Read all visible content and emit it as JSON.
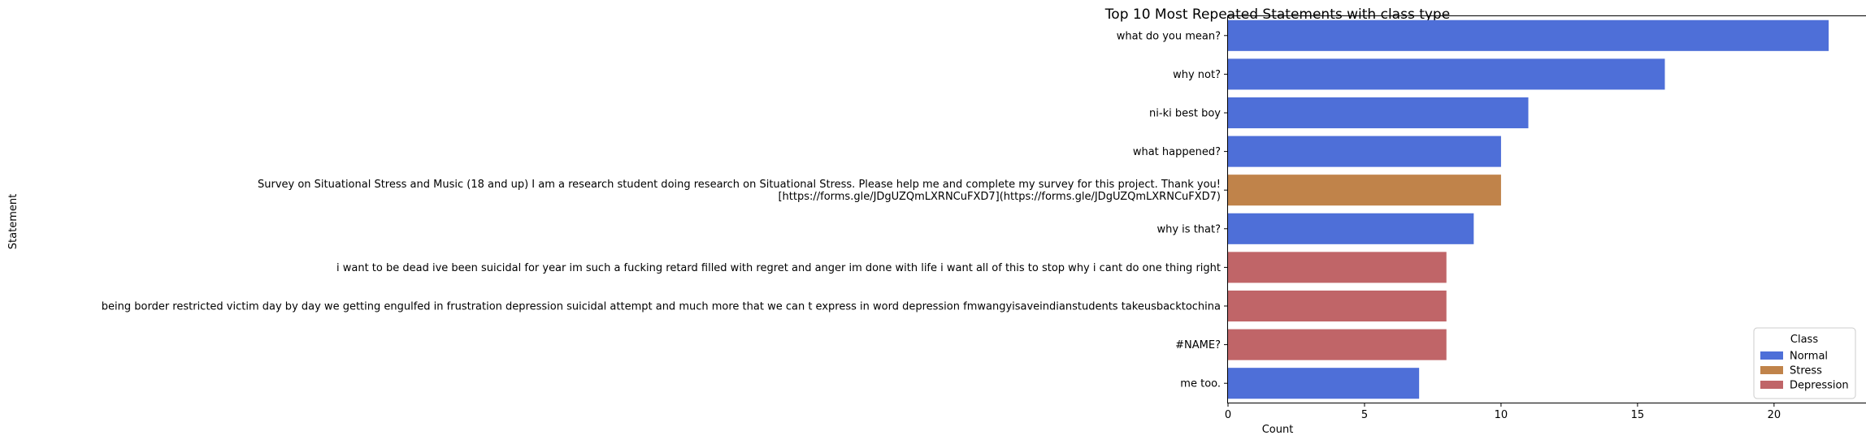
{
  "chart_data": {
    "type": "bar",
    "orientation": "horizontal",
    "title": "Top 10 Most Repeated Statements with class type",
    "xlabel": "Count",
    "ylabel": "Statement",
    "xlim": [
      0,
      23.1
    ],
    "xticks": [
      0,
      5,
      10,
      15,
      20
    ],
    "grid": false,
    "legend_title": "Class",
    "legend_position": "lower right",
    "classes": [
      {
        "name": "Normal",
        "color": "#4e6fd8"
      },
      {
        "name": "Stress",
        "color": "#c0834a"
      },
      {
        "name": "Depression",
        "color": "#c06568"
      }
    ],
    "bars": [
      {
        "label": [
          "what do you mean?"
        ],
        "value": 22,
        "class": "Normal"
      },
      {
        "label": [
          "why not?"
        ],
        "value": 16,
        "class": "Normal"
      },
      {
        "label": [
          "ni-ki best boy"
        ],
        "value": 11,
        "class": "Normal"
      },
      {
        "label": [
          "what happened?"
        ],
        "value": 10,
        "class": "Normal"
      },
      {
        "label": [
          "Survey on Situational Stress and Music (18 and up) I am a research student doing research on Situational Stress. Please help me and complete my survey for this project. Thank you!",
          "[https://forms.gle/JDgUZQmLXRNCuFXD7](https://forms.gle/JDgUZQmLXRNCuFXD7)"
        ],
        "value": 10,
        "class": "Stress"
      },
      {
        "label": [
          "why is that?"
        ],
        "value": 9,
        "class": "Normal"
      },
      {
        "label": [
          "i want to be dead ive been suicidal for year im such a fucking retard filled with regret and anger im done with life i want all of this to stop why i cant do one thing right"
        ],
        "value": 8,
        "class": "Depression"
      },
      {
        "label": [
          "being border restricted victim day by day we getting engulfed in frustration depression suicidal attempt and much more that we can t express in word depression fmwangyisaveindianstudents takeusbacktochina"
        ],
        "value": 8,
        "class": "Depression"
      },
      {
        "label": [
          "#NAME?"
        ],
        "value": 8,
        "class": "Depression"
      },
      {
        "label": [
          "me too."
        ],
        "value": 7,
        "class": "Normal"
      }
    ]
  }
}
